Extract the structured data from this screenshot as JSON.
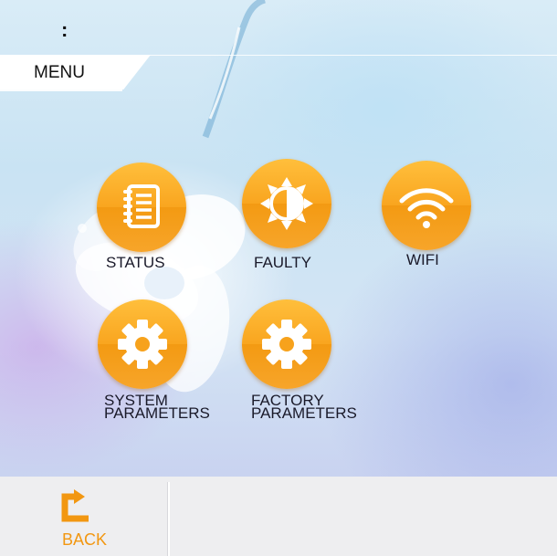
{
  "topbar": {
    "title": ":"
  },
  "menu_tab": {
    "label": "MENU"
  },
  "menu_items": [
    {
      "label": "STATUS",
      "icon": "document-list-icon"
    },
    {
      "label": "FAULTY",
      "icon": "half-sun-icon"
    },
    {
      "label": "WIFI",
      "icon": "wifi-icon"
    },
    {
      "label_line1": "SYSTEM",
      "label_line2": "PARAMETERS",
      "icon": "gear-icon"
    },
    {
      "label_line1": "FACTORY",
      "label_line2": "PARAMETERS",
      "icon": "gear-icon"
    }
  ],
  "footer": {
    "back_label": "BACK",
    "back_icon": "back-arrow-icon"
  },
  "colors": {
    "accent": "#f7a21c",
    "back_text": "#f29711",
    "footer_bg": "#eeeef0"
  }
}
